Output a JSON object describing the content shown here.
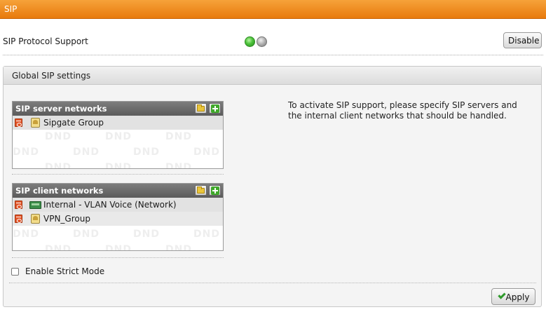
{
  "titlebar": {
    "title": "SIP"
  },
  "protocol": {
    "label": "SIP Protocol Support",
    "status_colors": [
      "#4cc23a",
      "#a8a8a8"
    ],
    "disable_label": "Disable"
  },
  "panel": {
    "title": "Global SIP settings",
    "server_networks": {
      "title": "SIP server networks",
      "items": [
        {
          "icon": "group-icon",
          "label": "Sipgate Group"
        }
      ]
    },
    "client_networks": {
      "title": "SIP client networks",
      "items": [
        {
          "icon": "network-icon",
          "label": "Internal - VLAN Voice (Network)"
        },
        {
          "icon": "group-icon",
          "label": "VPN_Group"
        }
      ]
    },
    "hint": "To activate SIP support, please specify SIP servers and the internal client networks that should be handled.",
    "strict_mode": {
      "label": "Enable Strict Mode",
      "checked": false
    },
    "apply_label": "Apply"
  }
}
